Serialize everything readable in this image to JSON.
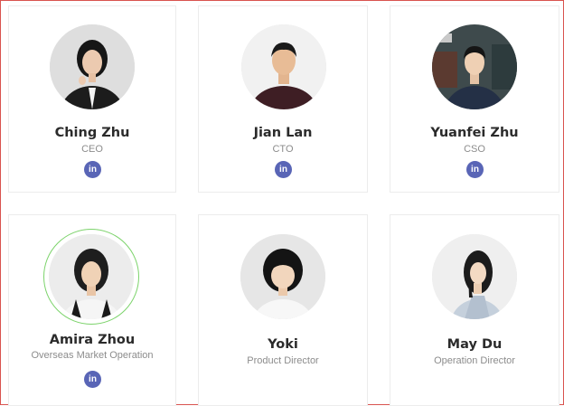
{
  "team": [
    {
      "name": "Ching Zhu",
      "role": "CEO",
      "linkedin": "in"
    },
    {
      "name": "Jian Lan",
      "role": "CTO",
      "linkedin": "in"
    },
    {
      "name": "Yuanfei Zhu",
      "role": "CSO",
      "linkedin": "in"
    },
    {
      "name": "Amira Zhou",
      "role": "Overseas Market Operation",
      "linkedin": "in"
    },
    {
      "name": "Yoki",
      "role": "Product Director"
    },
    {
      "name": "May Du",
      "role": "Operation Director"
    }
  ],
  "colors": {
    "linkedin_badge": "#5965b6",
    "highlight_ring": "#7cd36b",
    "page_border": "#d9534f"
  }
}
